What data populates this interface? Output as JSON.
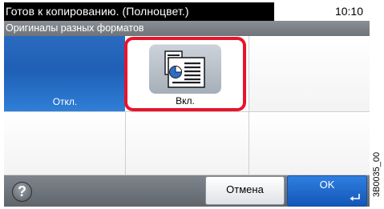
{
  "status_bar": {
    "message": "Готов к копированию. (Полноцвет.)",
    "clock": "10:10"
  },
  "title_bar": {
    "title": "Оригиналы разных форматов"
  },
  "options": {
    "off_label": "Откл.",
    "on_label": "Вкл.",
    "on_icon": "mixed-size-originals-icon",
    "selected": "Вкл."
  },
  "footer": {
    "help_icon": "help-icon",
    "help_glyph": "?",
    "cancel_label": "Отмена",
    "ok_label": "OK",
    "enter_icon": "enter-icon"
  },
  "side_code": "3B0035_00",
  "colors": {
    "selected_border": "#e8142b",
    "off_button": "#1f5fb5",
    "ok_button": "#1356b8"
  }
}
